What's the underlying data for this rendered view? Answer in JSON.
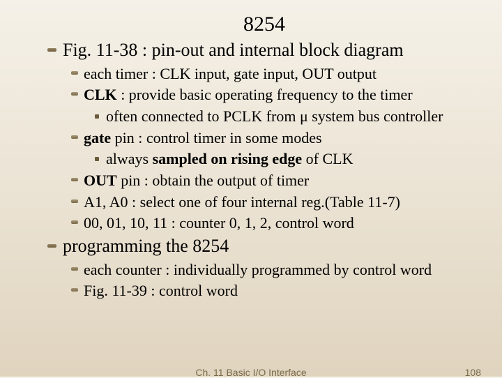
{
  "title": "8254",
  "items": [
    {
      "level": 1,
      "runs": [
        {
          "t": "Fig. 11-38 : pin-out and internal block diagram"
        }
      ]
    },
    {
      "level": 2,
      "runs": [
        {
          "t": "each timer : CLK input, gate input, OUT output"
        }
      ]
    },
    {
      "level": 2,
      "runs": [
        {
          "t": "CLK",
          "b": true
        },
        {
          "t": " : provide basic operating frequency to the timer"
        }
      ]
    },
    {
      "level": 3,
      "runs": [
        {
          "t": "often connected to PCLK from μ system bus controller"
        }
      ]
    },
    {
      "level": 2,
      "runs": [
        {
          "t": "gate",
          "b": true
        },
        {
          "t": " pin : control timer in some modes"
        }
      ]
    },
    {
      "level": 3,
      "runs": [
        {
          "t": "always "
        },
        {
          "t": "sampled on rising edge",
          "b": true
        },
        {
          "t": " of CLK"
        }
      ]
    },
    {
      "level": 2,
      "runs": [
        {
          "t": "OUT",
          "b": true
        },
        {
          "t": " pin : obtain the output of timer"
        }
      ]
    },
    {
      "level": 2,
      "runs": [
        {
          "t": "A1, A0 : select one of four internal reg.(Table 11-7)"
        }
      ]
    },
    {
      "level": 2,
      "runs": [
        {
          "t": "00, 01, 10, 11 : counter 0, 1, 2, control word"
        }
      ]
    },
    {
      "level": 1,
      "runs": [
        {
          "t": "programming the 8254"
        }
      ]
    },
    {
      "level": 2,
      "runs": [
        {
          "t": "each counter : individually programmed by control word"
        }
      ]
    },
    {
      "level": 2,
      "runs": [
        {
          "t": "Fig. 11-39 : control word"
        }
      ]
    }
  ],
  "footer": {
    "chapter": "Ch. 11 Basic I/O Interface",
    "page": "108"
  }
}
